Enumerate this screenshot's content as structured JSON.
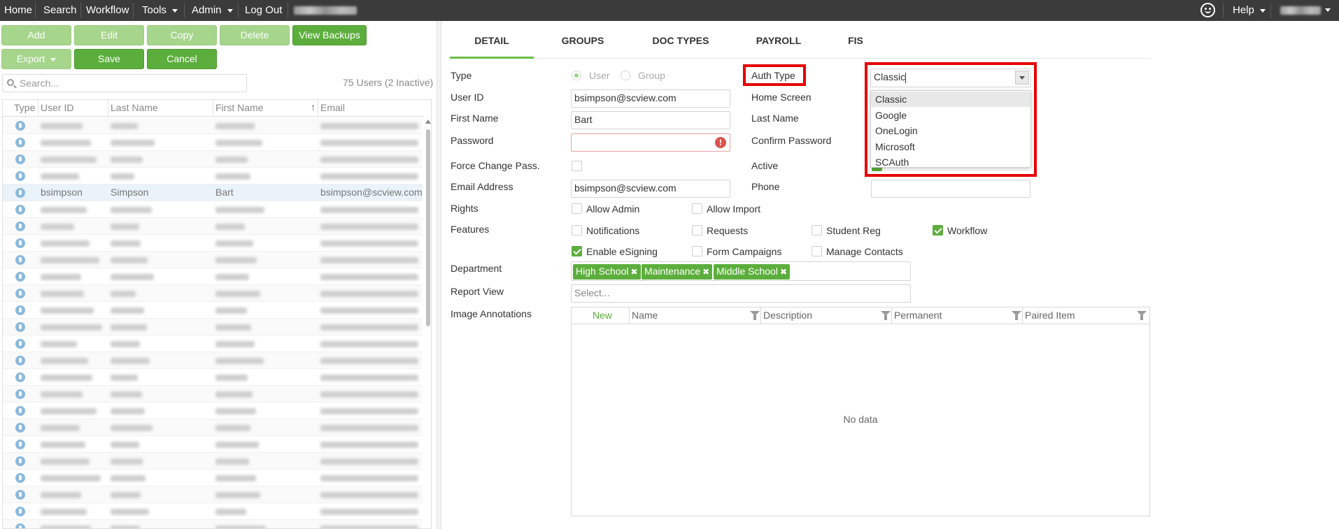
{
  "nav": {
    "home": "Home",
    "search": "Search",
    "workflow": "Workflow",
    "tools": "Tools",
    "admin": "Admin",
    "logout": "Log Out",
    "help": "Help"
  },
  "toolbar": {
    "add": "Add",
    "edit": "Edit",
    "copy": "Copy",
    "delete": "Delete",
    "view_backups": "View Backups",
    "export": "Export",
    "save": "Save",
    "cancel": "Cancel"
  },
  "users": {
    "search_placeholder": "Search...",
    "count": "75 Users (2 Inactive)",
    "columns": [
      "Type",
      "User ID",
      "Last Name",
      "First Name",
      "Email"
    ],
    "selected": {
      "user_id": "bsimpson",
      "last_name": "Simpson",
      "first_name": "Bart",
      "email": "bsimpson@scview.com"
    }
  },
  "tabs": [
    "DETAIL",
    "GROUPS",
    "DOC TYPES",
    "PAYROLL",
    "FIS"
  ],
  "form": {
    "type_label": "Type",
    "type_user": "User",
    "type_group": "Group",
    "user_id_label": "User ID",
    "user_id": "bsimpson@scview.com",
    "first_name_label": "First Name",
    "first_name": "Bart",
    "password_label": "Password",
    "force_change_label": "Force Change Pass.",
    "email_label": "Email Address",
    "email": "bsimpson@scview.com",
    "rights_label": "Rights",
    "allow_admin": "Allow Admin",
    "allow_import": "Allow Import",
    "features_label": "Features",
    "notifications": "Notifications",
    "requests": "Requests",
    "student_reg": "Student Reg",
    "workflow": "Workflow",
    "enable_esigning": "Enable eSigning",
    "form_campaigns": "Form Campaigns",
    "manage_contacts": "Manage Contacts",
    "department_label": "Department",
    "departments": [
      "High School",
      "Maintenance",
      "Middle School"
    ],
    "report_view_label": "Report View",
    "report_view_placeholder": "Select...",
    "image_annotations_label": "Image Annotations",
    "auth_type_label": "Auth Type",
    "auth_type_value": "Classic",
    "home_screen_label": "Home Screen",
    "last_name_label": "Last Name",
    "confirm_password_label": "Confirm Password",
    "active_label": "Active",
    "phone_label": "Phone",
    "auth_options": [
      "Classic",
      "Google",
      "OneLogin",
      "Microsoft",
      "SCAuth"
    ]
  },
  "annotations": {
    "new": "New",
    "columns": [
      "Name",
      "Description",
      "Permanent",
      "Paired Item"
    ],
    "empty": "No data"
  },
  "colors": {
    "accent": "#5cae3c",
    "accent_light": "#a6d58c",
    "highlight": "#e60000",
    "nav_bg": "#3b3b3b"
  }
}
